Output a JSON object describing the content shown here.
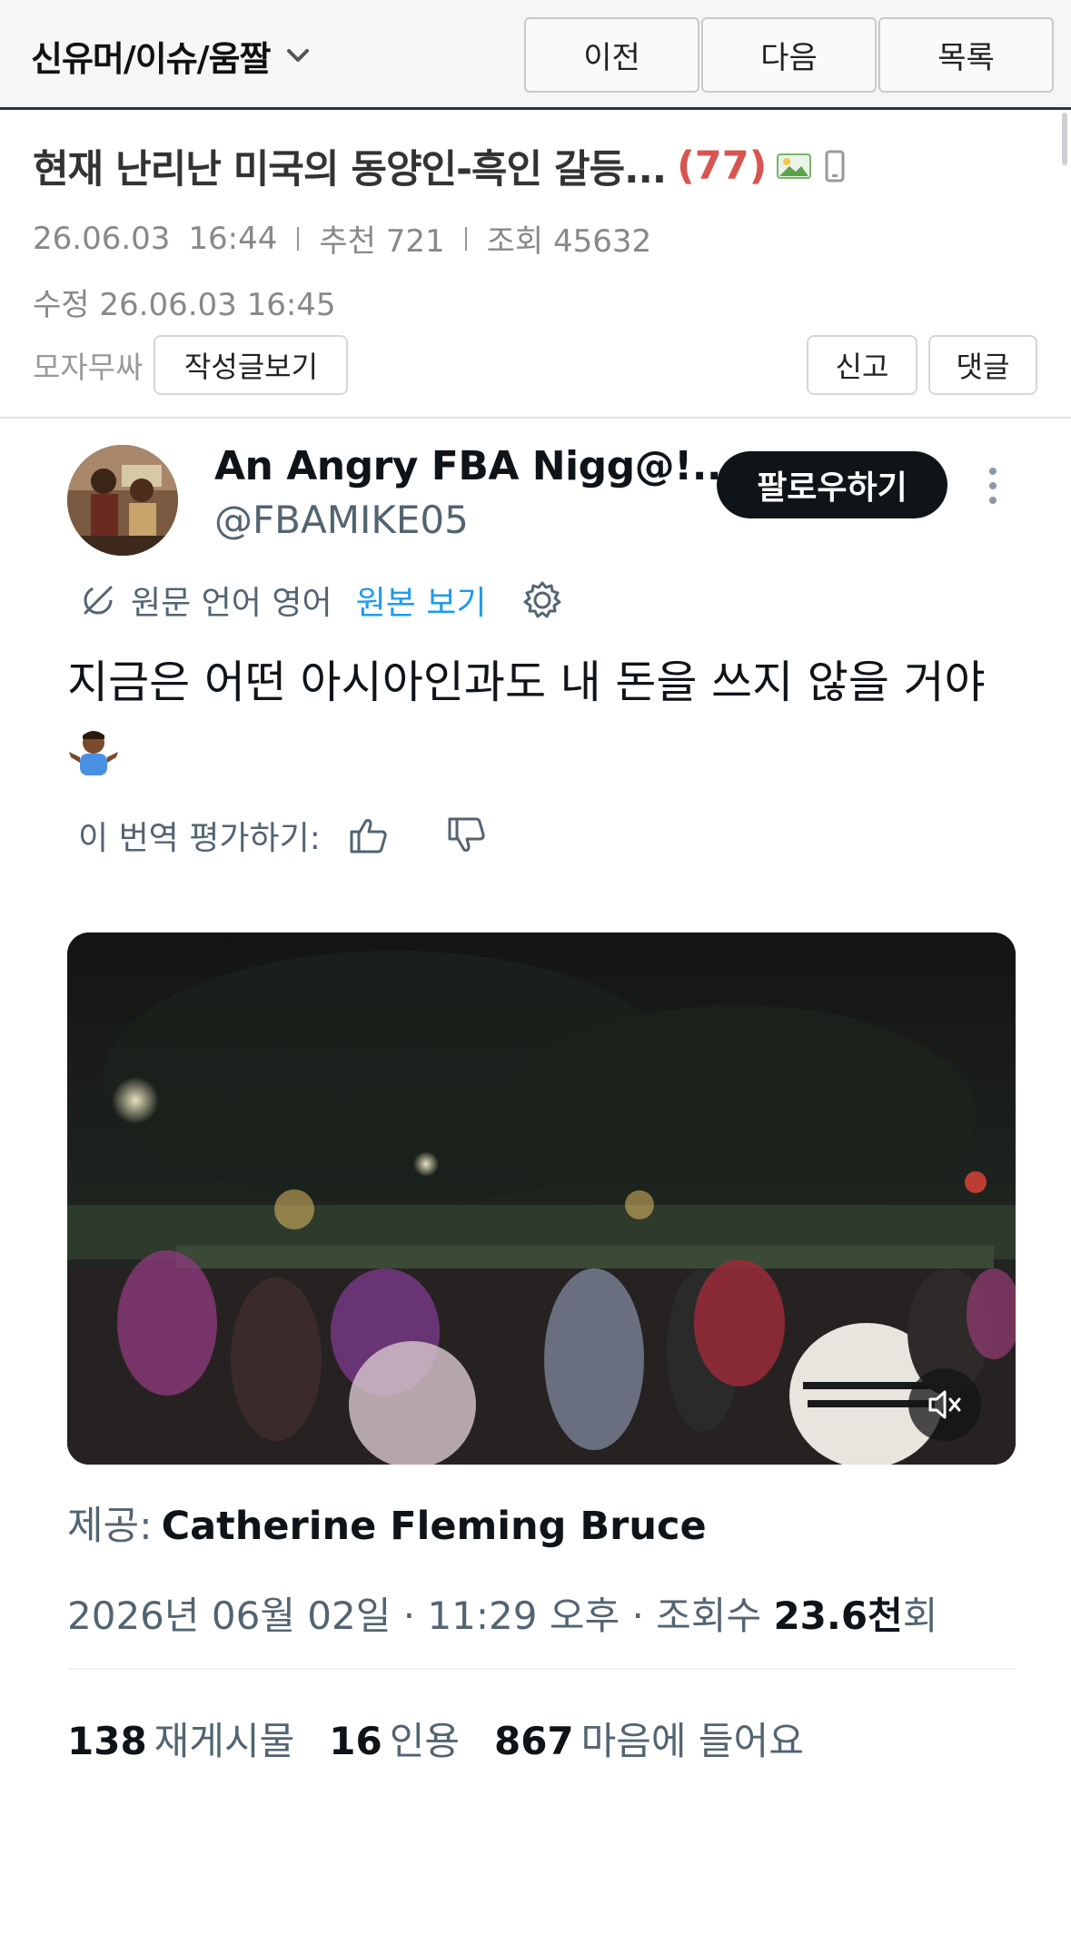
{
  "nav": {
    "board_name": "신유머/이슈/움짤",
    "prev_label": "이전",
    "next_label": "다음",
    "list_label": "목록"
  },
  "post": {
    "title": "현재 난리난 미국의 동양인-흑인 갈등...",
    "comment_count": "(77)",
    "date": "26.06.03",
    "time": "16:44",
    "recommend": "추천 721",
    "views": "조회 45632",
    "edited": "수정 26.06.03  16:45",
    "author": "모자무싸",
    "view_posts_label": "작성글보기",
    "report_label": "신고",
    "comment_label": "댓글"
  },
  "tweet": {
    "display_name": "An Angry FBA Nigg@!...",
    "handle": "@FBAMIKE05",
    "follow_label": "팔로우하기",
    "source_language": "원문 언어 영어",
    "view_original": "원본 보기",
    "text": "지금은 어떤 아시아인과도 내 돈을 쓰지 않을 거야",
    "rate_label": "이 번역 평가하기:",
    "provided_label": "제공:",
    "provided_by": "Catherine Fleming Bruce",
    "timestamp": "2026년 06월 02일 · 11:29 오후 · 조회수 ",
    "view_count": "23.6천",
    "view_count_suffix": "회",
    "stats": {
      "reposts_count": "138",
      "reposts_label": "재게시물",
      "quotes_count": "16",
      "quotes_label": "인용",
      "likes_count": "867",
      "likes_label": "마음에 들어요"
    }
  },
  "icons": {
    "board_dropdown": "chevron-down-icon",
    "image_attachment": "image-icon",
    "mobile": "mobile-icon",
    "translate": "translate-icon",
    "settings": "gear-icon",
    "thumbs_up": "thumbs-up-icon",
    "thumbs_down": "thumbs-down-icon",
    "more": "more-vertical-icon",
    "mute": "volume-mute-icon"
  },
  "colors": {
    "accent_red": "#d9534f",
    "link_blue": "#1d9bf0",
    "follow_bg": "#0f1419",
    "nav_border": "#2b3350"
  }
}
